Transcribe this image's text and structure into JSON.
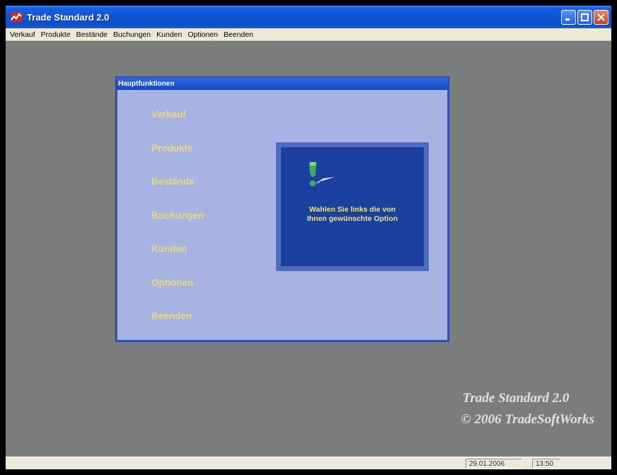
{
  "window": {
    "title": "Trade Standard 2.0",
    "icons": [
      "app-icon",
      "minimize-icon",
      "maximize-icon",
      "close-icon"
    ]
  },
  "menu": {
    "items": [
      "Verkauf",
      "Produkte",
      "Bestände",
      "Buchungen",
      "Kunden",
      "Optionen",
      "Beenden"
    ]
  },
  "panel": {
    "title": "Hauptfunktionen",
    "functions": [
      "Verkauf",
      "Produkte",
      "Bestände",
      "Buchungen",
      "Kunden",
      "Optionen",
      "Beenden"
    ],
    "info_text": "Wahlen Sie links die von\nIhnen gewünschte Option",
    "info_icon": "pointer-hand-icon"
  },
  "branding": {
    "line1": "Trade Standard 2.0",
    "line2": "© 2006 TradeSoftWorks"
  },
  "status": {
    "date": "29.01.2006",
    "time": "13:50"
  },
  "colors": {
    "desktop": "#7b7d7d",
    "panel_bg": "#a8b3e3",
    "info_bg": "#1b40a0",
    "accent_text": "#e6d97a"
  }
}
